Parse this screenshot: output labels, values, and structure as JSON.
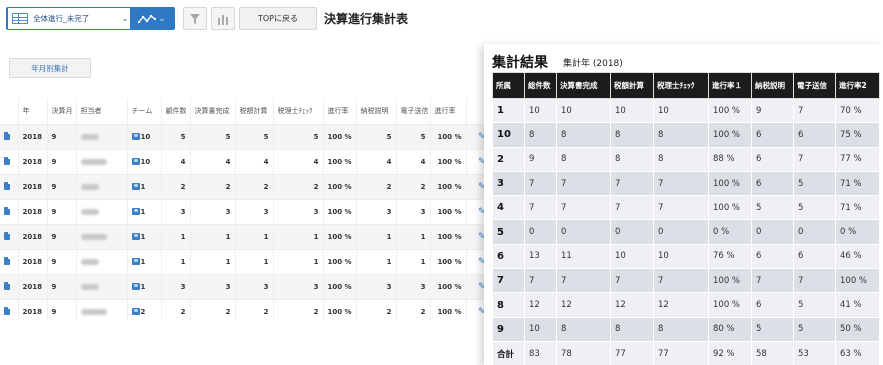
{
  "toolbar": {
    "view_select_value": "全体進行_未完了",
    "top_button_label": "TOPに戻る",
    "icons": {
      "table_icon": "table-icon",
      "chart_type_icon": "line-chart-icon",
      "filter_icon": "funnel-icon",
      "bar_chart_icon": "bar-chart-icon",
      "dropdown_icon": "chevron-down-icon"
    }
  },
  "page_title": "決算進行集計表",
  "month_button_label": "年月別集計",
  "left_table": {
    "headers": [
      "年",
      "決算月",
      "担当者",
      "チーム",
      "顧件数",
      "決算書完成",
      "税額計算",
      "税理士ﾁｪｯｸ",
      "進行率",
      "納税説明",
      "電子送信",
      "進行率"
    ],
    "rows": [
      {
        "year": "2018",
        "month": "9",
        "team": "10",
        "c1": "5",
        "c2": "5",
        "c3": "5",
        "c4": "5",
        "rate": "100 %",
        "c5": "5",
        "c6": "5",
        "rate2": "100 %"
      },
      {
        "year": "2018",
        "month": "9",
        "team": "10",
        "c1": "4",
        "c2": "4",
        "c3": "4",
        "c4": "4",
        "rate": "100 %",
        "c5": "4",
        "c6": "4",
        "rate2": "100 %"
      },
      {
        "year": "2018",
        "month": "9",
        "team": "1",
        "c1": "2",
        "c2": "2",
        "c3": "2",
        "c4": "2",
        "rate": "100 %",
        "c5": "2",
        "c6": "2",
        "rate2": "100 %"
      },
      {
        "year": "2018",
        "month": "9",
        "team": "1",
        "c1": "3",
        "c2": "3",
        "c3": "3",
        "c4": "3",
        "rate": "100 %",
        "c5": "3",
        "c6": "3",
        "rate2": "100 %"
      },
      {
        "year": "2018",
        "month": "9",
        "team": "1",
        "c1": "1",
        "c2": "1",
        "c3": "1",
        "c4": "1",
        "rate": "100 %",
        "c5": "1",
        "c6": "1",
        "rate2": "100 %"
      },
      {
        "year": "2018",
        "month": "9",
        "team": "1",
        "c1": "1",
        "c2": "1",
        "c3": "1",
        "c4": "1",
        "rate": "100 %",
        "c5": "1",
        "c6": "1",
        "rate2": "100 %"
      },
      {
        "year": "2018",
        "month": "9",
        "team": "1",
        "c1": "3",
        "c2": "3",
        "c3": "3",
        "c4": "3",
        "rate": "100 %",
        "c5": "3",
        "c6": "3",
        "rate2": "100 %"
      },
      {
        "year": "2018",
        "month": "9",
        "team": "2",
        "c1": "2",
        "c2": "2",
        "c3": "2",
        "c4": "2",
        "rate": "100 %",
        "c5": "2",
        "c6": "2",
        "rate2": "100 %"
      }
    ]
  },
  "summary": {
    "title": "集計結果",
    "subtitle": "集計年 (2018)",
    "headers": [
      "所属",
      "総件数",
      "決算書完成",
      "税額計算",
      "税理士ﾁｪｯｸ",
      "進行率１",
      "納税説明",
      "電子送信",
      "進行率2"
    ],
    "rows": [
      [
        "1",
        "10",
        "10",
        "10",
        "10",
        "100 %",
        "9",
        "7",
        "70 %"
      ],
      [
        "10",
        "8",
        "8",
        "8",
        "8",
        "100 %",
        "6",
        "6",
        "75 %"
      ],
      [
        "2",
        "9",
        "8",
        "8",
        "8",
        "88 %",
        "6",
        "7",
        "77 %"
      ],
      [
        "3",
        "7",
        "7",
        "7",
        "7",
        "100 %",
        "6",
        "5",
        "71 %"
      ],
      [
        "4",
        "7",
        "7",
        "7",
        "7",
        "100 %",
        "5",
        "5",
        "71 %"
      ],
      [
        "5",
        "0",
        "0",
        "0",
        "0",
        "0 %",
        "0",
        "0",
        "0 %"
      ],
      [
        "6",
        "13",
        "11",
        "10",
        "10",
        "76 %",
        "6",
        "6",
        "46 %"
      ],
      [
        "7",
        "7",
        "7",
        "7",
        "7",
        "100 %",
        "7",
        "7",
        "100 %"
      ],
      [
        "8",
        "12",
        "12",
        "12",
        "12",
        "100 %",
        "6",
        "5",
        "41 %"
      ],
      [
        "9",
        "10",
        "8",
        "8",
        "8",
        "80 %",
        "5",
        "5",
        "50 %"
      ]
    ],
    "total": [
      "合計",
      "83",
      "78",
      "77",
      "77",
      "92 %",
      "58",
      "53",
      "63 %"
    ]
  }
}
